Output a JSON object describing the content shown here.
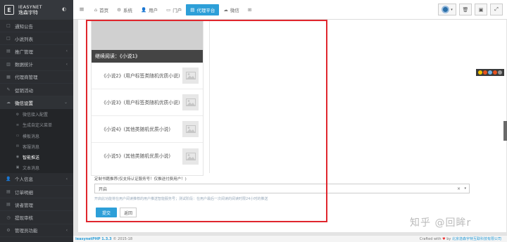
{
  "brand": {
    "logo_letter": "E",
    "name_en": "IEASYNET",
    "name_cn": "逸森宇特",
    "dropdown": "◐"
  },
  "sidebar": {
    "items": [
      {
        "icon": "□",
        "label": "通知公告"
      },
      {
        "icon": "□",
        "label": "小说列表"
      },
      {
        "icon": "▤",
        "label": "推广管理",
        "caret": "‹"
      },
      {
        "icon": "▥",
        "label": "数据统计",
        "caret": "‹"
      },
      {
        "icon": "▦",
        "label": "代理商管理"
      },
      {
        "icon": "✎",
        "label": "促销活动"
      },
      {
        "icon": "☁",
        "label": "微信设置",
        "caret": "⌄"
      }
    ],
    "subitems": [
      {
        "icon": "⚙",
        "label": "微信接入配置"
      },
      {
        "icon": "≡",
        "label": "生成自定义菜单"
      },
      {
        "icon": "▭",
        "label": "模板消息"
      },
      {
        "icon": "✉",
        "label": "客服消息"
      },
      {
        "icon": "◉",
        "label": "智能推送"
      },
      {
        "icon": "▣",
        "label": "文本消息"
      }
    ],
    "items_bottom": [
      {
        "icon": "👤",
        "label": "个人信息",
        "caret": "‹"
      },
      {
        "icon": "▤",
        "label": "订单明细"
      },
      {
        "icon": "▤",
        "label": "读者管理"
      },
      {
        "icon": "◷",
        "label": "提现审核"
      },
      {
        "icon": "⚙",
        "label": "管理员功能",
        "caret": "‹"
      }
    ]
  },
  "topbar": {
    "burger": "≡",
    "nav": [
      {
        "icon": "⌂",
        "label": "首页"
      },
      {
        "icon": "⚙",
        "label": "系统"
      },
      {
        "icon": "👤",
        "label": "用户"
      },
      {
        "icon": "▭",
        "label": "门户"
      },
      {
        "icon": "▤",
        "label": "代理平台"
      },
      {
        "icon": "☁",
        "label": "微信"
      },
      {
        "icon": "⊞",
        "label": ""
      }
    ],
    "user_caret": "▾",
    "buttons": [
      "🗑",
      "▣",
      "⤢"
    ]
  },
  "preview": {
    "heading": "继续阅读：《小说1》",
    "items": [
      "《小说2》(用户标签类随机优质小说)",
      "《小说3》(用户标签类随机优质小说)",
      "《小说4》(其他类随机优质小说)",
      "《小说5》(其他类随机优质小说)"
    ]
  },
  "form": {
    "label": "定制书籍推荐(仅支持认证服务号！仅推送付费用户！)",
    "select_value": "开启",
    "clear": "×",
    "dropdown": "▾",
    "hint": "开启此功能将在用户阅读推荐的用户推送智能服务号；测试阶段：在用户最后一次阅读的阅读时限24小时的推送",
    "submit_label": "提交",
    "back_label": "返回"
  },
  "footer": {
    "brandname": "ieasynetPHP 1.3.3",
    "copyright": "© 2015-18",
    "crafted": "Crafted with",
    "heart": "♥",
    "by": "by",
    "company": "北京逸森宇特互联科技有限公司"
  },
  "watermark": "知乎 @回眸r",
  "colors": {
    "accent": "#2d9fd8",
    "sidebar_bg": "#2b2d31",
    "highlight_border": "#e0262d"
  }
}
